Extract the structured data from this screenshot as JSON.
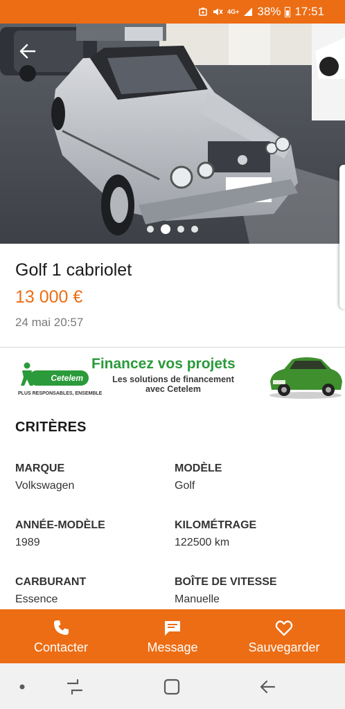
{
  "status_bar": {
    "network": "4G+",
    "battery": "38%",
    "time": "17:51",
    "accent_color": "#ec6d14"
  },
  "gallery": {
    "image_count": 4,
    "active_index": 1
  },
  "listing": {
    "title": "Golf 1 cabriolet",
    "price": "13 000 €",
    "date": "24 mai 20:57"
  },
  "ad": {
    "brand": "Cetelem",
    "tagline": "PLUS RESPONSABLES, ENSEMBLE",
    "headline": "Financez vos projets",
    "subline_1": "Les solutions de financement",
    "subline_2": "avec Cetelem"
  },
  "criteria": {
    "title": "CRITÈRES",
    "items": [
      {
        "label": "MARQUE",
        "value": "Volkswagen"
      },
      {
        "label": "MODÈLE",
        "value": "Golf"
      },
      {
        "label": "ANNÉE-MODÈLE",
        "value": "1989"
      },
      {
        "label": "KILOMÉTRAGE",
        "value": "122500 km"
      },
      {
        "label": "CARBURANT",
        "value": "Essence"
      },
      {
        "label": "BOÎTE DE VITESSE",
        "value": "Manuelle"
      }
    ]
  },
  "actions": {
    "contact": "Contacter",
    "message": "Message",
    "save": "Sauvegarder"
  },
  "icons": {
    "back": "arrow-left-icon",
    "contact": "phone-icon",
    "message": "chat-bubble-icon",
    "save": "heart-icon"
  }
}
